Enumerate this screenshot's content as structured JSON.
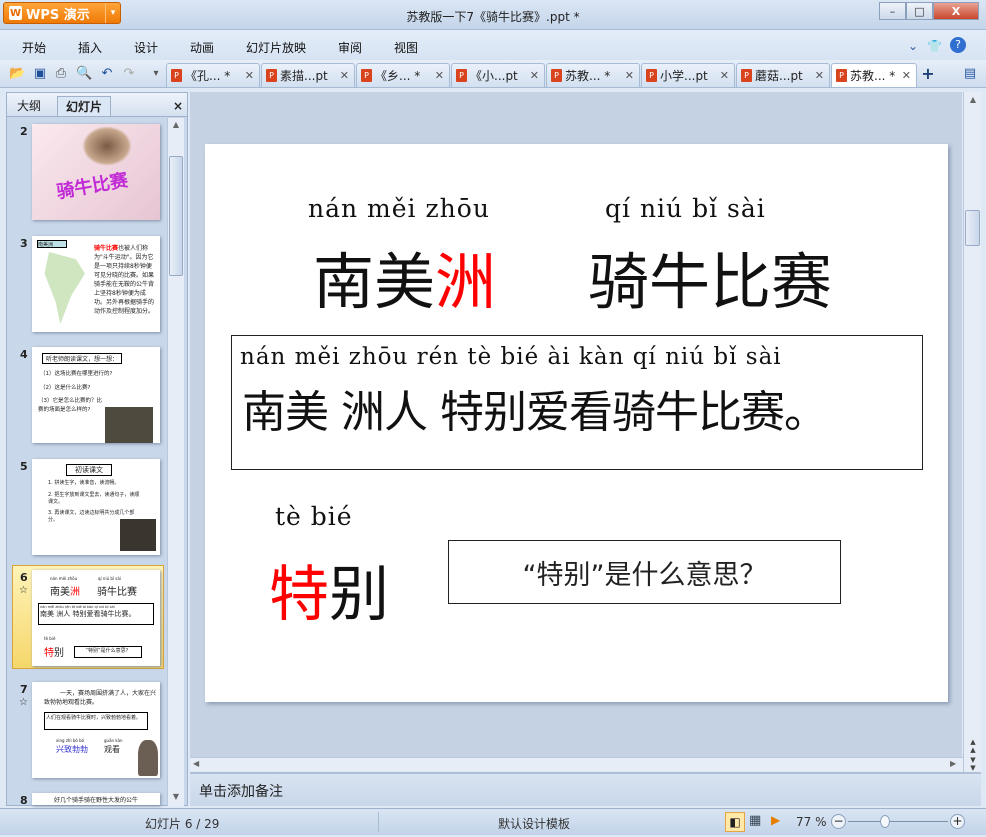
{
  "app": {
    "name": "WPS 演示",
    "title": "苏教版一下7《骑牛比赛》.ppt *"
  },
  "window_buttons": {
    "minimize": "–",
    "maximize": "□",
    "close": "X"
  },
  "menu": [
    "开始",
    "插入",
    "设计",
    "动画",
    "幻灯片放映",
    "审阅",
    "视图"
  ],
  "doc_tabs": [
    {
      "label": "《孔... *",
      "active": false
    },
    {
      "label": "素描...pt",
      "active": false
    },
    {
      "label": "《乡... *",
      "active": false
    },
    {
      "label": "《小...pt",
      "active": false
    },
    {
      "label": "苏教... *",
      "active": false
    },
    {
      "label": "小学...pt",
      "active": false
    },
    {
      "label": "蘑菇...pt",
      "active": false
    },
    {
      "label": "苏教... *",
      "active": true
    }
  ],
  "panel": {
    "tabs": [
      "大纲",
      "幻灯片"
    ],
    "close": "×"
  },
  "thumbnails": [
    {
      "num": "2",
      "title": "骑牛比赛"
    },
    {
      "num": "3",
      "label": "南美洲",
      "title": "骑牛比赛",
      "text": "也被人们称为\"斗牛运动\"。因为它是一项只持续8秒钟便可见分晓的比赛。如果骑手能在无鞍的公牛背上坚持8秒钟便为成功。另外再根据骑手的动作及控制程度加分。"
    },
    {
      "num": "4",
      "box": "听老师朗读课文，想一想：",
      "lines": [
        "（1）这场比赛在哪里进行的?",
        "（2）这是什么比赛?",
        "（3）它是怎么比赛的？比赛的场面是怎么样的?"
      ]
    },
    {
      "num": "5",
      "box": "初读课文",
      "lines": [
        "1. 拼读生字，读准音，读流畅。",
        "2. 把生字放到课文里去，读通句子，读顺课文。",
        "3. 再读课文，边读边标明共分成几个部分。"
      ]
    },
    {
      "num": "6",
      "star": "☆"
    },
    {
      "num": "7",
      "star": "☆",
      "lines": [
        "一天，赛场周围挤满了人，大家在兴致勃勃地观看比赛。"
      ],
      "box": "人们在观看骑牛比赛时，兴致勃勃地看着。",
      "pinyin1": "xìng zhì bó bó",
      "words1": "兴致勃勃",
      "pinyin2": "guān kàn",
      "words2": "观看"
    },
    {
      "num": "8",
      "lines": [
        "好几个骑手骑在野性大发的公牛"
      ]
    }
  ],
  "slide": {
    "pinyin1": "nán měi zhōu",
    "word1a": "南美",
    "word1b": "洲",
    "pinyin2": "qí niú bǐ sài",
    "word2": "骑牛比赛",
    "sentence_pinyin": "nán měi zhōu rén tè bié ài kàn qí niú bǐ sài",
    "sentence": "南美 洲人 特别爱看骑牛比赛。",
    "pinyin3": "tè  bié",
    "word3a": "特",
    "word3b": "别",
    "question": "“特别”是什么意思？"
  },
  "notes_placeholder": "单击添加备注",
  "status": {
    "slide": "幻灯片 6 / 29",
    "template": "默认设计模板",
    "zoom": "77 %",
    "zoom_percent": 77
  },
  "colors": {
    "accent": "#ef7a06",
    "highlight": "#ff0000"
  }
}
